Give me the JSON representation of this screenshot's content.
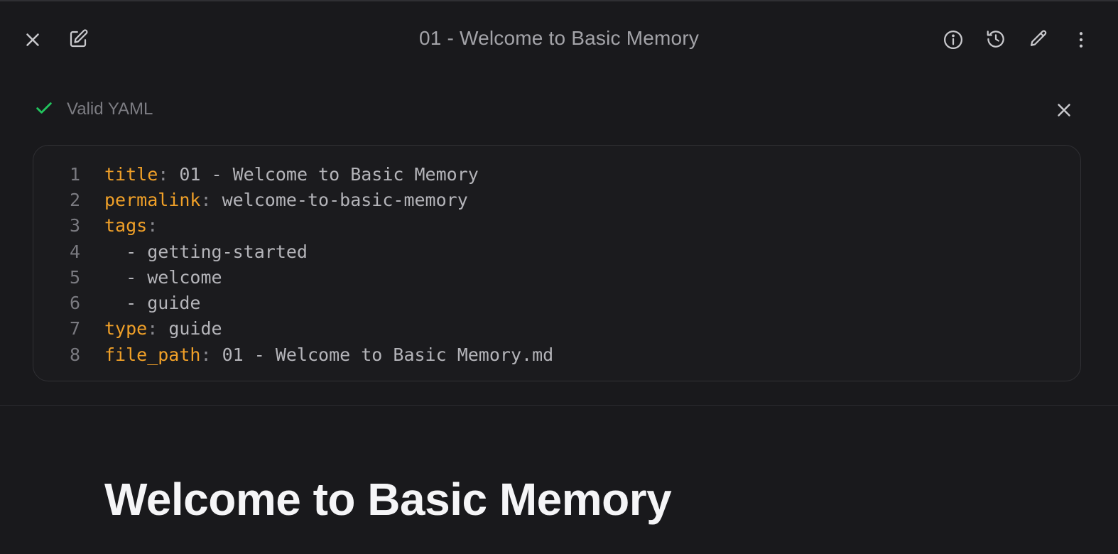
{
  "header": {
    "title": "01 - Welcome to Basic Memory",
    "left_icons": [
      "close-icon",
      "edit-note-icon"
    ],
    "right_icons": [
      "info-icon",
      "history-icon",
      "pencil-icon",
      "more-vertical-icon"
    ]
  },
  "yaml": {
    "status_label": "Valid YAML",
    "status_color": "#22c55e",
    "lines": [
      {
        "num": "1",
        "indent": "",
        "key": "title",
        "sep": ": ",
        "value": "01 - Welcome to Basic Memory"
      },
      {
        "num": "2",
        "indent": "",
        "key": "permalink",
        "sep": ": ",
        "value": "welcome-to-basic-memory"
      },
      {
        "num": "3",
        "indent": "",
        "key": "tags",
        "sep": ":",
        "value": ""
      },
      {
        "num": "4",
        "indent": "  ",
        "key": "",
        "sep": "- ",
        "value": "getting-started"
      },
      {
        "num": "5",
        "indent": "  ",
        "key": "",
        "sep": "- ",
        "value": "welcome"
      },
      {
        "num": "6",
        "indent": "  ",
        "key": "",
        "sep": "- ",
        "value": "guide"
      },
      {
        "num": "7",
        "indent": "",
        "key": "type",
        "sep": ": ",
        "value": "guide"
      },
      {
        "num": "8",
        "indent": "",
        "key": "file_path",
        "sep": ": ",
        "value": "01 - Welcome to Basic Memory.md"
      }
    ]
  },
  "document": {
    "heading": "Welcome to Basic Memory"
  },
  "colors": {
    "background": "#19191c",
    "key": "#f0a028",
    "heading": "#f5f5f7"
  }
}
